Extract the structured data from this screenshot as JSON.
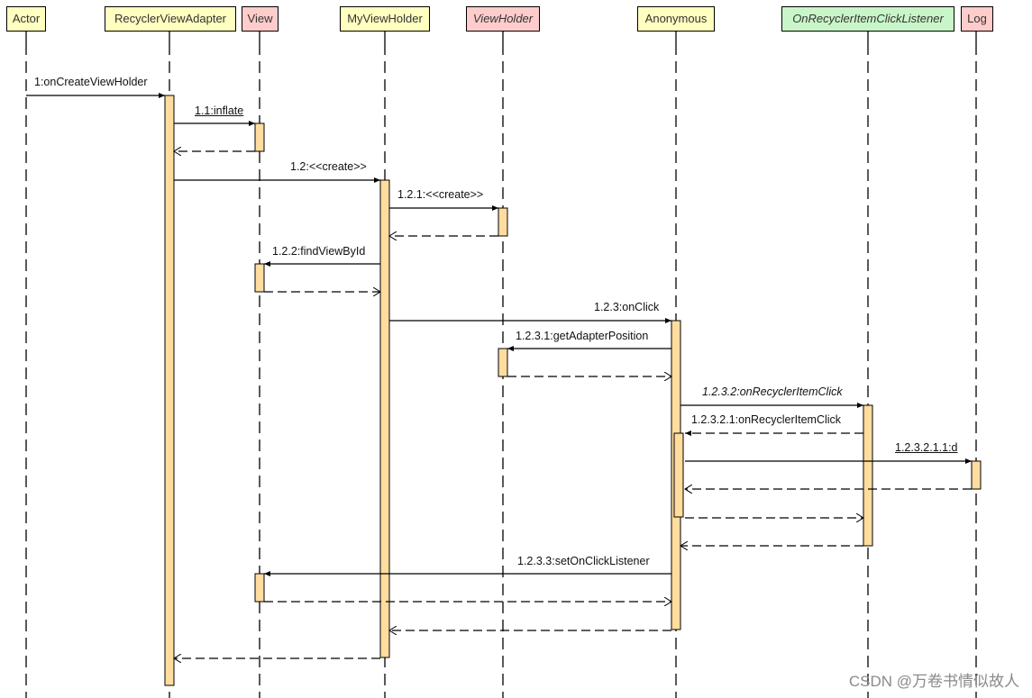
{
  "diagram": {
    "type": "uml-sequence",
    "participants": [
      {
        "id": "actor",
        "label": "Actor",
        "style": "yellow",
        "italic": false
      },
      {
        "id": "adapter",
        "label": "RecyclerViewAdapter",
        "style": "yellow",
        "italic": false
      },
      {
        "id": "view",
        "label": "View",
        "style": "pink",
        "italic": false
      },
      {
        "id": "myviewholder",
        "label": "MyViewHolder",
        "style": "yellow",
        "italic": false
      },
      {
        "id": "viewholder",
        "label": "ViewHolder",
        "style": "pink",
        "italic": true
      },
      {
        "id": "anonymous",
        "label": "Anonymous",
        "style": "yellow",
        "italic": false
      },
      {
        "id": "listener",
        "label": "OnRecyclerItemClickListener",
        "style": "green",
        "italic": true
      },
      {
        "id": "log",
        "label": "Log",
        "style": "pink",
        "italic": false
      }
    ],
    "messages": [
      {
        "from": "actor",
        "to": "adapter",
        "label": "1:onCreateViewHolder",
        "kind": "call"
      },
      {
        "from": "adapter",
        "to": "view",
        "label": "1.1:inflate",
        "kind": "call",
        "underline": true
      },
      {
        "from": "view",
        "to": "adapter",
        "label": "",
        "kind": "return"
      },
      {
        "from": "adapter",
        "to": "myviewholder",
        "label": "1.2:<<create>>",
        "kind": "call"
      },
      {
        "from": "myviewholder",
        "to": "viewholder",
        "label": "1.2.1:<<create>>",
        "kind": "call"
      },
      {
        "from": "viewholder",
        "to": "myviewholder",
        "label": "",
        "kind": "return"
      },
      {
        "from": "myviewholder",
        "to": "view",
        "label": "1.2.2:findViewById",
        "kind": "call"
      },
      {
        "from": "view",
        "to": "myviewholder",
        "label": "",
        "kind": "return"
      },
      {
        "from": "myviewholder",
        "to": "anonymous",
        "label": "1.2.3:onClick",
        "kind": "call"
      },
      {
        "from": "anonymous",
        "to": "viewholder",
        "label": "1.2.3.1:getAdapterPosition",
        "kind": "call"
      },
      {
        "from": "viewholder",
        "to": "anonymous",
        "label": "",
        "kind": "return"
      },
      {
        "from": "anonymous",
        "to": "listener",
        "label": "1.2.3.2:onRecyclerItemClick",
        "kind": "call",
        "italic": true
      },
      {
        "from": "listener",
        "to": "anonymous",
        "label": "1.2.3.2.1:onRecyclerItemClick",
        "kind": "callback"
      },
      {
        "from": "anonymous",
        "to": "log",
        "label": "1.2.3.2.1.1:d",
        "kind": "call",
        "underline": true
      },
      {
        "from": "log",
        "to": "anonymous",
        "label": "",
        "kind": "return"
      },
      {
        "from": "anonymous",
        "to": "listener",
        "label": "",
        "kind": "return"
      },
      {
        "from": "listener",
        "to": "anonymous",
        "label": "",
        "kind": "return"
      },
      {
        "from": "anonymous",
        "to": "view",
        "label": "1.2.3.3:setOnClickListener",
        "kind": "call"
      },
      {
        "from": "view",
        "to": "anonymous",
        "label": "",
        "kind": "return"
      },
      {
        "from": "anonymous",
        "to": "myviewholder",
        "label": "",
        "kind": "return"
      },
      {
        "from": "myviewholder",
        "to": "adapter",
        "label": "",
        "kind": "return"
      }
    ],
    "colors": {
      "activation_fill": "#ffdd9f",
      "line": "#000000",
      "header_yellow": "#ffffc0",
      "header_pink": "#ffcccc",
      "header_green": "#c9f6c9"
    }
  },
  "watermark": "CSDN @万卷书情似故人"
}
